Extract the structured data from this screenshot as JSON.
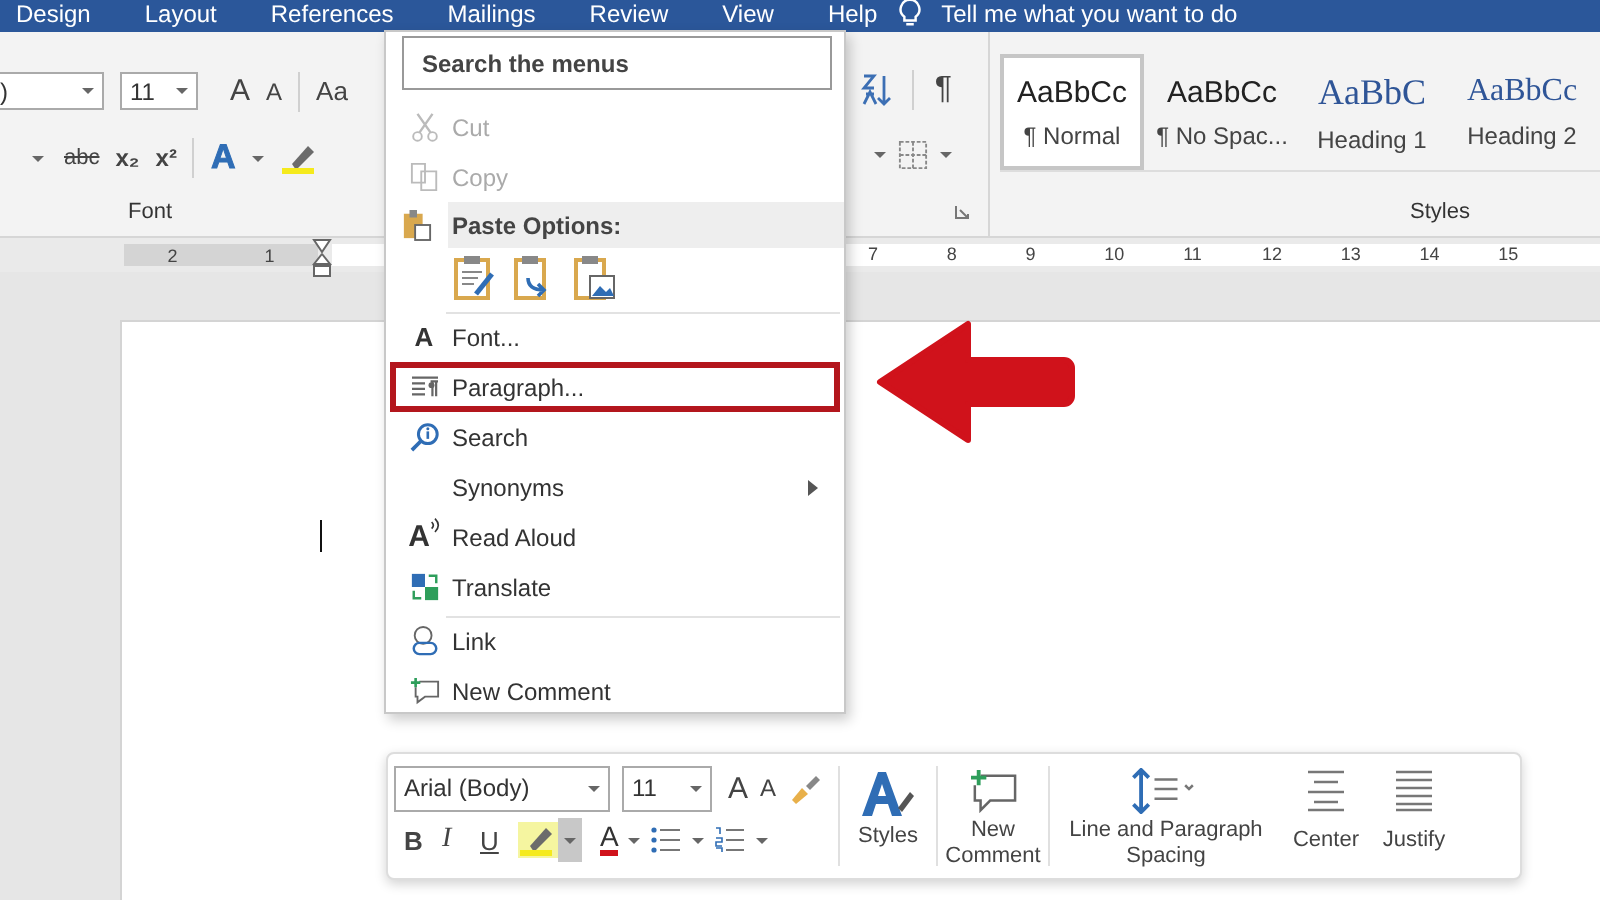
{
  "tabs": [
    {
      "label": "Design"
    },
    {
      "label": "Layout"
    },
    {
      "label": "References"
    },
    {
      "label": "Mailings"
    },
    {
      "label": "Review"
    },
    {
      "label": "View"
    },
    {
      "label": "Help"
    }
  ],
  "tell_me": {
    "text": "Tell me what you want to do"
  },
  "font_group": {
    "font_name": ")",
    "font_size": "11",
    "grow_font": "A",
    "shrink_font": "A",
    "change_case": "Aa",
    "strikethrough": "abc",
    "subscript": "x₂",
    "superscript": "x²",
    "text_effects": "A",
    "label": "Font"
  },
  "paragraph_group": {
    "show_marks": "¶"
  },
  "styles_group": {
    "label": "Styles",
    "items": [
      {
        "preview": "AaBbCc",
        "name": "¶ Normal",
        "kind": "body",
        "selected": true
      },
      {
        "preview": "AaBbCc",
        "name": "¶ No Spac...",
        "kind": "body",
        "selected": false
      },
      {
        "preview": "AaBbC",
        "name": "Heading 1",
        "kind": "heading1",
        "selected": false
      },
      {
        "preview": "AaBbCc",
        "name": "Heading 2",
        "kind": "heading2",
        "selected": false
      }
    ]
  },
  "ruler": {
    "left_numbers": [
      "2",
      "1"
    ],
    "right_numbers": [
      "7",
      "8",
      "9",
      "10",
      "11",
      "12",
      "13",
      "14",
      "15"
    ]
  },
  "context_menu": {
    "search": {
      "placeholder": "Search the menus"
    },
    "items": [
      {
        "kind": "command",
        "label": "Cut",
        "disabled": true,
        "highlighted": false,
        "submenu": false,
        "separator_before": false
      },
      {
        "kind": "command",
        "label": "Copy",
        "disabled": true,
        "highlighted": false,
        "submenu": false,
        "separator_before": false
      },
      {
        "kind": "header",
        "label": "Paste Options:"
      },
      {
        "kind": "paste_options"
      },
      {
        "kind": "command",
        "label": "Font...",
        "icon_text": "A",
        "disabled": false,
        "highlighted": false,
        "submenu": false,
        "separator_before": true
      },
      {
        "kind": "command",
        "label": "Paragraph...",
        "disabled": false,
        "highlighted": true,
        "submenu": false,
        "separator_before": false
      },
      {
        "kind": "command",
        "label": "Search",
        "disabled": false,
        "highlighted": false,
        "submenu": false,
        "separator_before": false
      },
      {
        "kind": "command",
        "label": "Synonyms",
        "disabled": false,
        "highlighted": false,
        "submenu": true,
        "separator_before": false
      },
      {
        "kind": "command",
        "label": "Read Aloud",
        "icon_text": "A",
        "disabled": false,
        "highlighted": false,
        "submenu": false,
        "separator_before": false
      },
      {
        "kind": "command",
        "label": "Translate",
        "disabled": false,
        "highlighted": false,
        "submenu": false,
        "separator_before": false
      },
      {
        "kind": "command",
        "label": "Link",
        "disabled": false,
        "highlighted": false,
        "submenu": false,
        "separator_before": true
      },
      {
        "kind": "command",
        "label": "New Comment",
        "disabled": false,
        "highlighted": false,
        "submenu": false,
        "separator_before": false
      }
    ]
  },
  "mini_toolbar": {
    "font_name": "Arial (Body)",
    "font_size": "11",
    "grow_font": "A",
    "shrink_font": "A",
    "bold": "B",
    "italic": "I",
    "underline": "U",
    "font_color": "A",
    "buttons": [
      {
        "label": "Styles"
      },
      {
        "label": "New Comment"
      },
      {
        "label": "Line and Paragraph Spacing"
      },
      {
        "label": "Center"
      },
      {
        "label": "Justify"
      }
    ]
  }
}
